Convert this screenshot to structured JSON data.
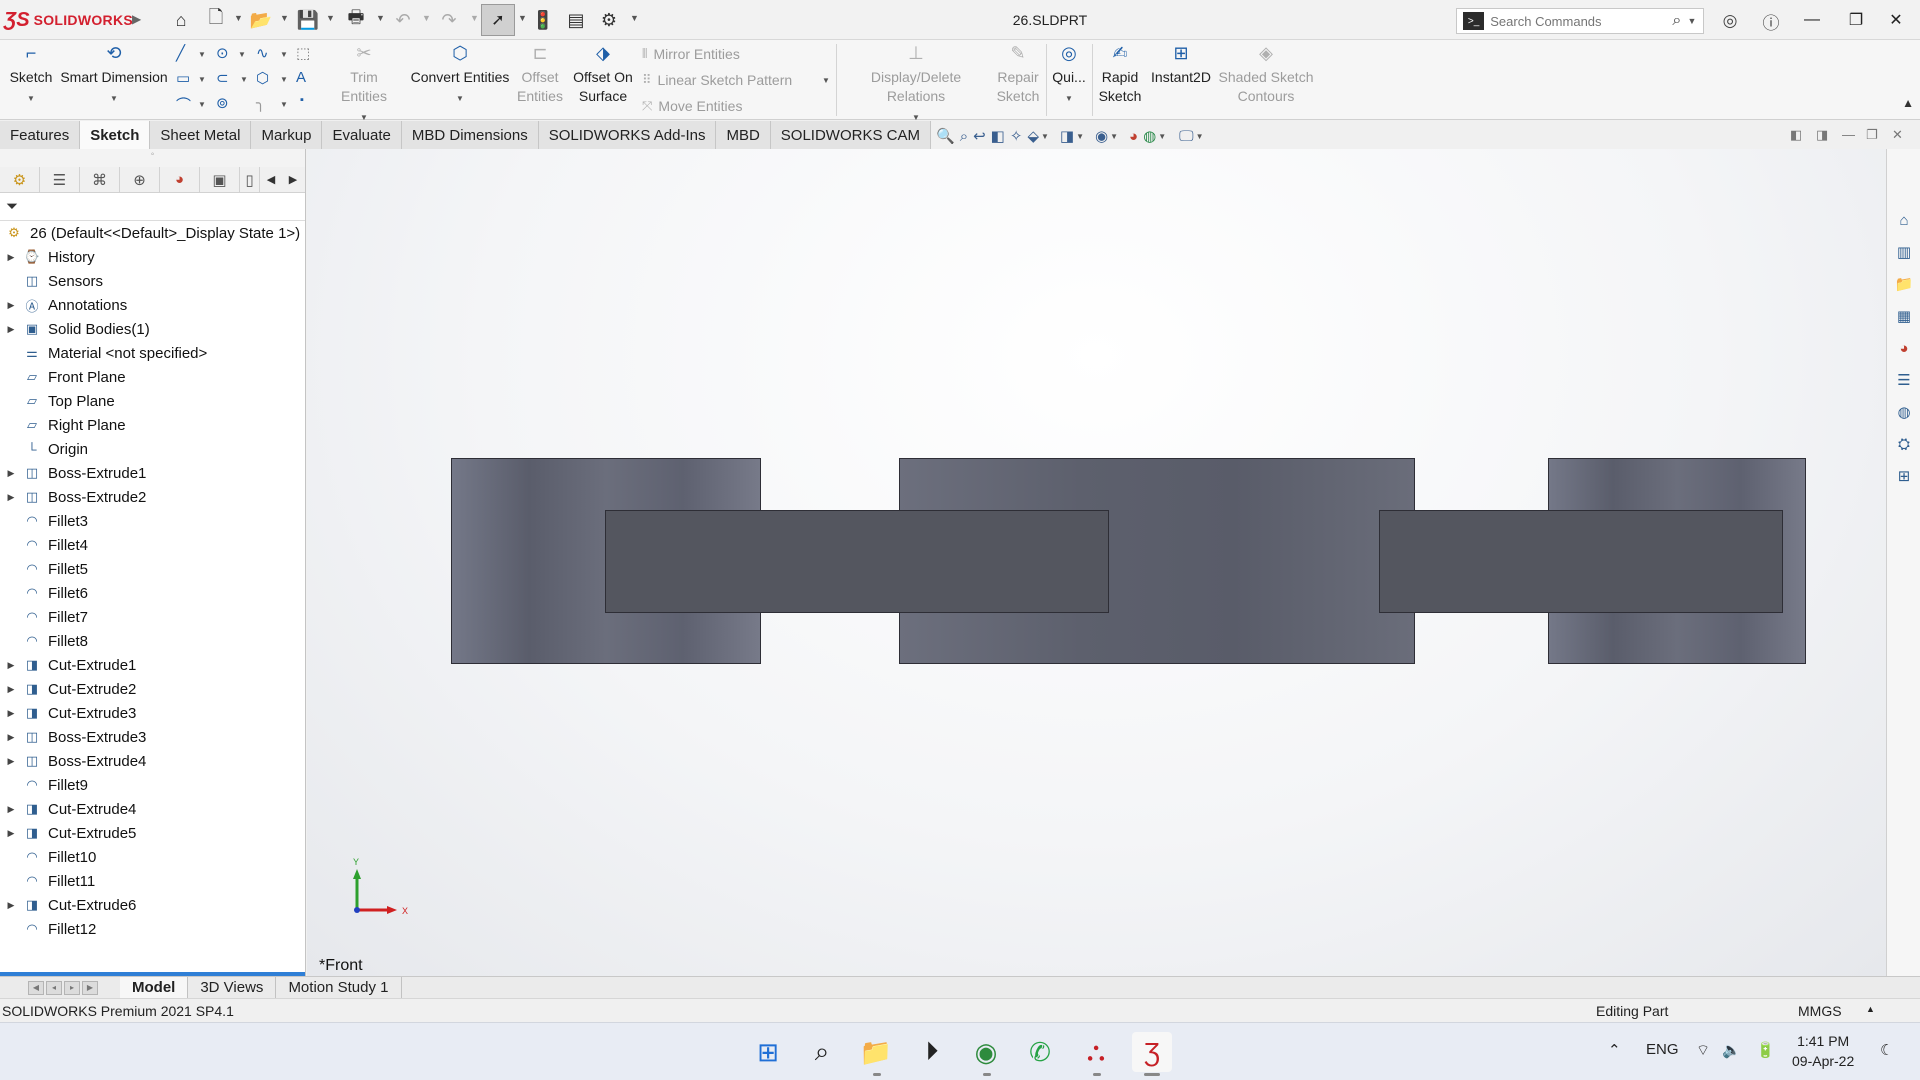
{
  "app": {
    "brand_bold": "SOLIDWORKS",
    "doc_title": "26.SLDPRT"
  },
  "search": {
    "placeholder": "Search Commands"
  },
  "commands": {
    "sketch": "Sketch",
    "smart_dimension": "Smart Dimension",
    "trim_entities": "Trim Entities",
    "convert_entities": "Convert Entities",
    "offset_entities_1": "Offset",
    "offset_entities_2": "Entities",
    "offset_on_surface_1": "Offset On",
    "offset_on_surface_2": "Surface",
    "mirror_entities": "Mirror Entities",
    "linear_sketch_pattern": "Linear Sketch Pattern",
    "move_entities": "Move Entities",
    "display_delete_relations": "Display/Delete Relations",
    "repair_sketch_1": "Repair",
    "repair_sketch_2": "Sketch",
    "quick_snaps": "Qui...",
    "rapid_sketch_1": "Rapid",
    "rapid_sketch_2": "Sketch",
    "instant2d": "Instant2D",
    "shaded_contours_1": "Shaded Sketch",
    "shaded_contours_2": "Contours"
  },
  "tabs": [
    {
      "label": "Features",
      "active": false
    },
    {
      "label": "Sketch",
      "active": true
    },
    {
      "label": "Sheet Metal",
      "active": false
    },
    {
      "label": "Markup",
      "active": false
    },
    {
      "label": "Evaluate",
      "active": false
    },
    {
      "label": "MBD Dimensions",
      "active": false
    },
    {
      "label": "SOLIDWORKS Add-Ins",
      "active": false
    },
    {
      "label": "MBD",
      "active": false
    },
    {
      "label": "SOLIDWORKS CAM",
      "active": false
    }
  ],
  "tree": [
    {
      "label": "26  (Default<<Default>_Display State 1>)",
      "icon": "part-icon",
      "expandable": false,
      "root": true
    },
    {
      "label": "History",
      "icon": "history-folder-icon",
      "expandable": true
    },
    {
      "label": "Sensors",
      "icon": "sensors-folder-icon",
      "expandable": false
    },
    {
      "label": "Annotations",
      "icon": "annotations-icon",
      "expandable": true
    },
    {
      "label": "Solid Bodies(1)",
      "icon": "solid-bodies-icon",
      "expandable": true
    },
    {
      "label": "Material <not specified>",
      "icon": "material-icon",
      "expandable": false
    },
    {
      "label": "Front Plane",
      "icon": "plane-icon",
      "expandable": false
    },
    {
      "label": "Top Plane",
      "icon": "plane-icon",
      "expandable": false
    },
    {
      "label": "Right Plane",
      "icon": "plane-icon",
      "expandable": false
    },
    {
      "label": "Origin",
      "icon": "origin-icon",
      "expandable": false
    },
    {
      "label": "Boss-Extrude1",
      "icon": "extrude-icon",
      "expandable": true
    },
    {
      "label": "Boss-Extrude2",
      "icon": "extrude-icon",
      "expandable": true
    },
    {
      "label": "Fillet3",
      "icon": "fillet-icon",
      "expandable": false
    },
    {
      "label": "Fillet4",
      "icon": "fillet-icon",
      "expandable": false
    },
    {
      "label": "Fillet5",
      "icon": "fillet-icon",
      "expandable": false
    },
    {
      "label": "Fillet6",
      "icon": "fillet-icon",
      "expandable": false
    },
    {
      "label": "Fillet7",
      "icon": "fillet-icon",
      "expandable": false
    },
    {
      "label": "Fillet8",
      "icon": "fillet-icon",
      "expandable": false
    },
    {
      "label": "Cut-Extrude1",
      "icon": "cut-extrude-icon",
      "expandable": true
    },
    {
      "label": "Cut-Extrude2",
      "icon": "cut-extrude-icon",
      "expandable": true
    },
    {
      "label": "Cut-Extrude3",
      "icon": "cut-extrude-icon",
      "expandable": true
    },
    {
      "label": "Boss-Extrude3",
      "icon": "extrude-icon",
      "expandable": true
    },
    {
      "label": "Boss-Extrude4",
      "icon": "extrude-icon",
      "expandable": true
    },
    {
      "label": "Fillet9",
      "icon": "fillet-icon",
      "expandable": false
    },
    {
      "label": "Cut-Extrude4",
      "icon": "cut-extrude-icon",
      "expandable": true
    },
    {
      "label": "Cut-Extrude5",
      "icon": "cut-extrude-icon",
      "expandable": true
    },
    {
      "label": "Fillet10",
      "icon": "fillet-icon",
      "expandable": false
    },
    {
      "label": "Fillet11",
      "icon": "fillet-icon",
      "expandable": false
    },
    {
      "label": "Cut-Extrude6",
      "icon": "cut-extrude-icon",
      "expandable": true
    },
    {
      "label": "Fillet12",
      "icon": "fillet-icon",
      "expandable": false
    }
  ],
  "viewport": {
    "view_label": "*Front",
    "triad_x": "X",
    "triad_y": "Y"
  },
  "bottom_tabs": [
    {
      "label": "Model",
      "active": true
    },
    {
      "label": "3D Views",
      "active": false
    },
    {
      "label": "Motion Study 1",
      "active": false
    }
  ],
  "status": {
    "version": "SOLIDWORKS Premium 2021 SP4.1",
    "mode": "Editing Part",
    "units": "MMGS"
  },
  "taskbar": {
    "lang": "ENG",
    "time": "1:41 PM",
    "date": "09-Apr-22"
  },
  "colors": {
    "brand": "#d3202f",
    "selection": "#2f7fd6"
  }
}
